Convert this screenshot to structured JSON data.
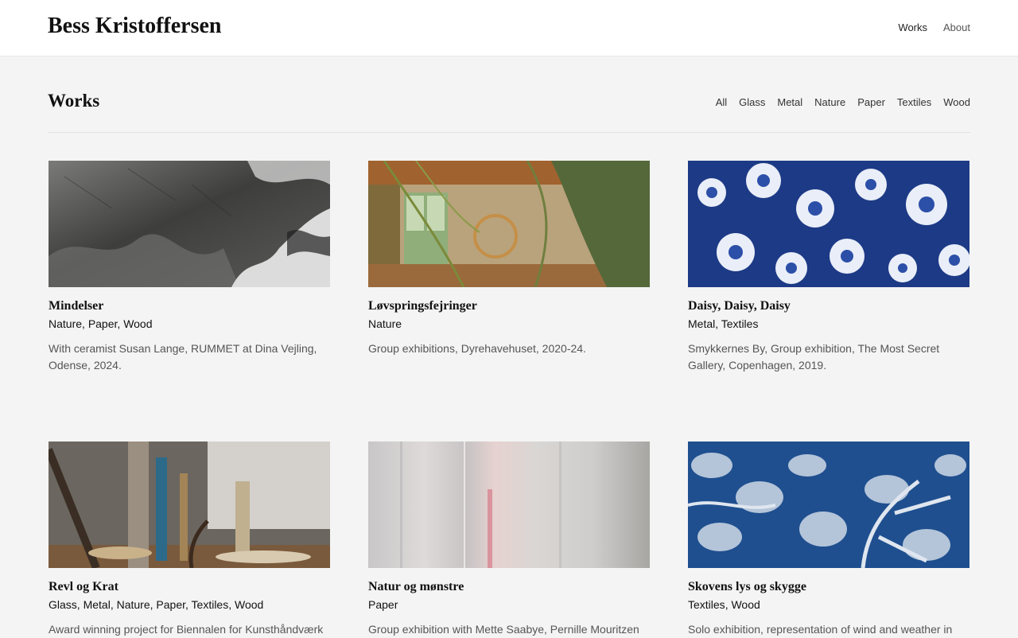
{
  "site": {
    "title": "Bess Kristoffersen"
  },
  "nav": [
    {
      "label": "Works"
    },
    {
      "label": "About"
    }
  ],
  "heading": "Works",
  "filters": [
    "All",
    "Glass",
    "Metal",
    "Nature",
    "Paper",
    "Textiles",
    "Wood"
  ],
  "works": [
    {
      "title": "Mindelser",
      "tags": [
        "Nature",
        "Paper",
        "Wood"
      ],
      "description": "With ceramist Susan Lange, RUMMET at Dina Vejling, Odense, 2024.",
      "image": "ink-wash-paper-photo"
    },
    {
      "title": "Løvspringsfejringer",
      "tags": [
        "Nature"
      ],
      "description": "Group exhibitions, Dyrehavehuset, 2020-24.",
      "image": "grass-installation-photo"
    },
    {
      "title": "Daisy, Daisy, Daisy",
      "tags": [
        "Metal",
        "Textiles"
      ],
      "description": "Smykkernes By, Group exhibition, The Most Secret Gallery, Copenhagen, 2019.",
      "image": "blue-daisy-buttons-photo"
    },
    {
      "title": "Revl og Krat",
      "tags": [
        "Glass",
        "Metal",
        "Nature",
        "Paper",
        "Textiles",
        "Wood"
      ],
      "description": "Award winning project for Biennalen for Kunsthåndværk",
      "image": "mixed-media-installation-photo"
    },
    {
      "title": "Natur og mønstre",
      "tags": [
        "Paper"
      ],
      "description": "Group exhibition with Mette Saabye, Pernille Mouritzen",
      "image": "paper-curtain-photo"
    },
    {
      "title": "Skovens lys og skygge",
      "tags": [
        "Textiles",
        "Wood"
      ],
      "description": "Solo exhibition, representation of wind and weather in",
      "image": "cyanotype-leaves-photo"
    }
  ]
}
